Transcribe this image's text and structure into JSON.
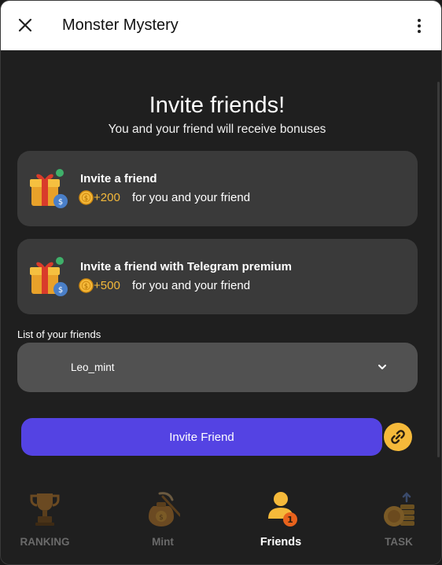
{
  "header": {
    "title": "Monster Mystery"
  },
  "main": {
    "heading": "Invite friends!",
    "subheading": "You and your friend will receive bonuses",
    "cards": [
      {
        "title": "Invite a friend",
        "amount": "+200",
        "desc": "for you and your friend"
      },
      {
        "title": "Invite a friend with Telegram premium",
        "amount": "+500",
        "desc": "for you and your friend"
      }
    ],
    "list_label": "List of your friends",
    "friends_select": {
      "value": "Leo_mint"
    },
    "invite_button": "Invite Friend"
  },
  "nav": {
    "items": [
      {
        "label": "RANKING",
        "active": false
      },
      {
        "label": "Mint",
        "active": false
      },
      {
        "label": "Friends",
        "active": true,
        "badge": "1"
      },
      {
        "label": "TASK",
        "active": false
      }
    ]
  },
  "colors": {
    "accent": "#5443e3",
    "coin": "#f5b93a",
    "card_bg": "#3a3a3a"
  }
}
